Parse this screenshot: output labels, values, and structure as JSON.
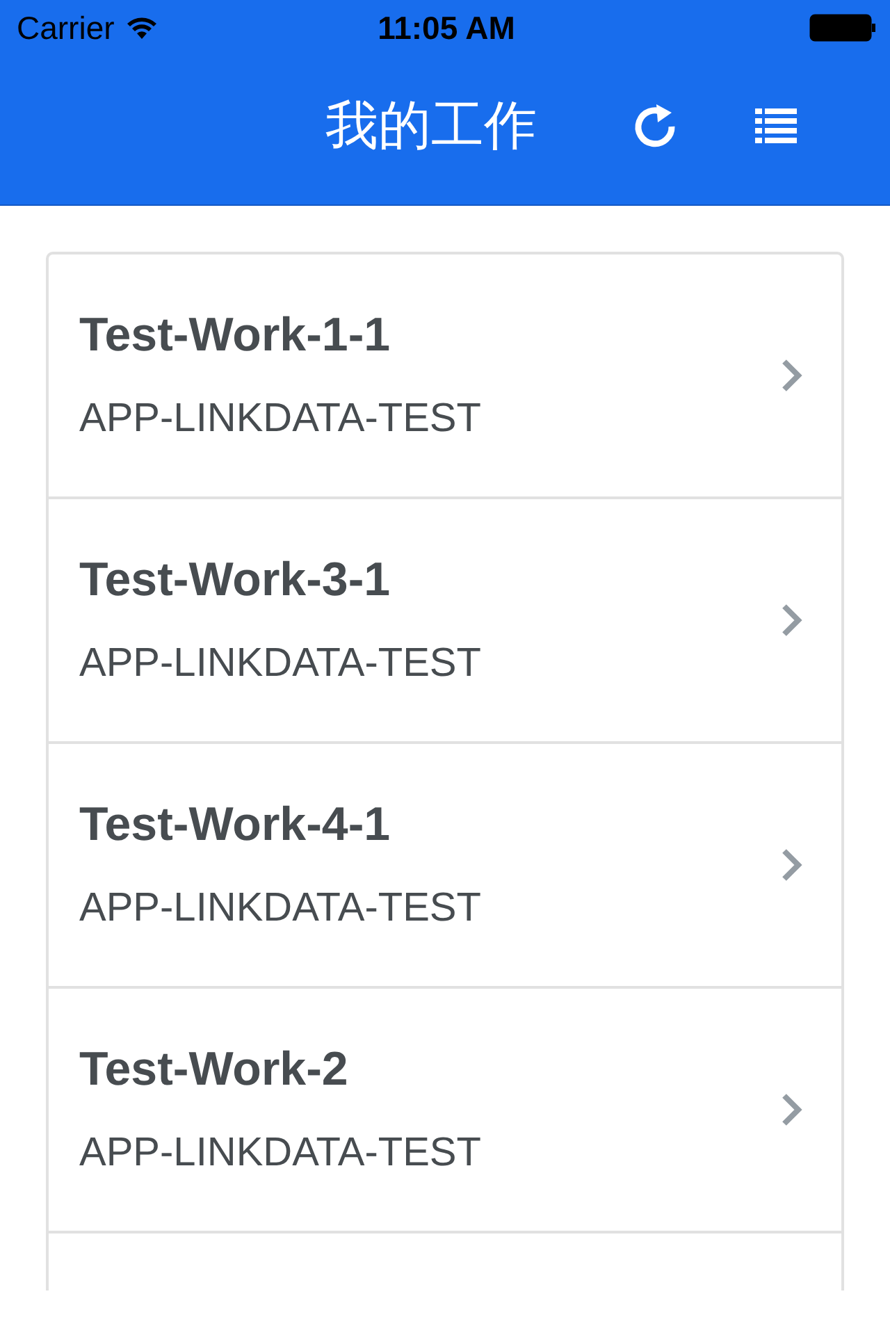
{
  "status_bar": {
    "carrier": "Carrier",
    "time": "11:05 AM"
  },
  "nav_bar": {
    "title": "我的工作"
  },
  "works": [
    {
      "title": "Test-Work-1-1",
      "project": "APP-LINKDATA-TEST"
    },
    {
      "title": "Test-Work-3-1",
      "project": "APP-LINKDATA-TEST"
    },
    {
      "title": "Test-Work-4-1",
      "project": "APP-LINKDATA-TEST"
    },
    {
      "title": "Test-Work-2",
      "project": "APP-LINKDATA-TEST"
    }
  ]
}
